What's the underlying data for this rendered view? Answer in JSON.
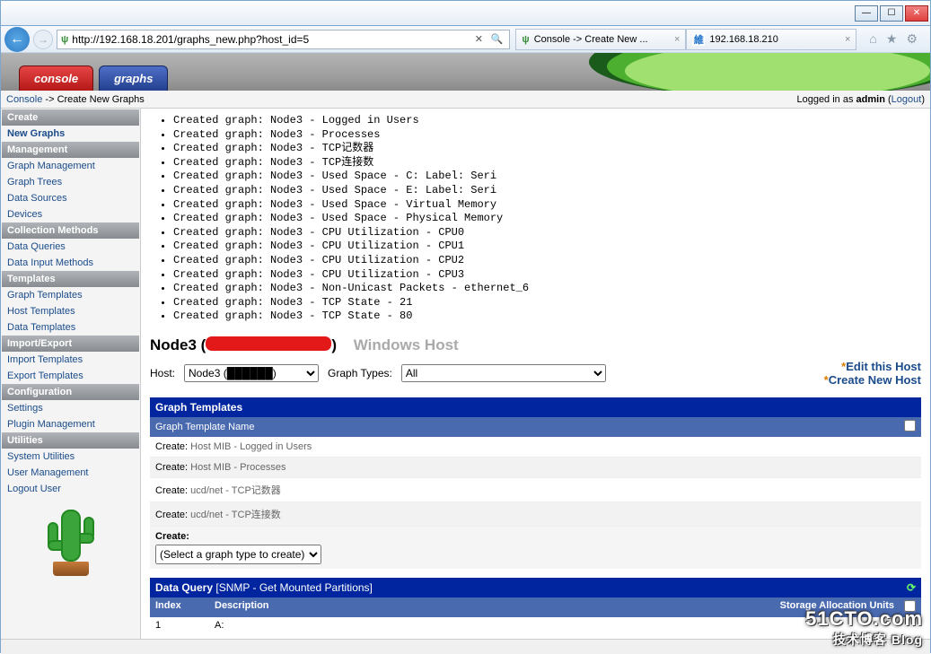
{
  "browser": {
    "url": "http://192.168.18.201/graphs_new.php?host_id=5",
    "tabs": [
      {
        "label": "Console -> Create New ..."
      },
      {
        "label": "192.168.18.210",
        "icon_text": "維"
      }
    ]
  },
  "cacti_tabs": {
    "console": "console",
    "graphs": "graphs"
  },
  "breadcrumb": {
    "console": "Console",
    "arrow": "->",
    "page": "Create New Graphs",
    "login_pre": "Logged in as ",
    "user": "admin",
    "logout": "Logout"
  },
  "sidebar": {
    "headers": {
      "create": "Create",
      "management": "Management",
      "collection": "Collection Methods",
      "templates": "Templates",
      "import_export": "Import/Export",
      "configuration": "Configuration",
      "utilities": "Utilities"
    },
    "links": {
      "new_graphs": "New Graphs",
      "graph_management": "Graph Management",
      "graph_trees": "Graph Trees",
      "data_sources": "Data Sources",
      "devices": "Devices",
      "data_queries": "Data Queries",
      "data_input": "Data Input Methods",
      "graph_templates": "Graph Templates",
      "host_templates": "Host Templates",
      "data_templates": "Data Templates",
      "import_templates": "Import Templates",
      "export_templates": "Export Templates",
      "settings": "Settings",
      "plugin_mgmt": "Plugin Management",
      "sys_util": "System Utilities",
      "user_mgmt": "User Management",
      "logout_user": "Logout User"
    }
  },
  "log_lines": [
    "Created graph: Node3 - Logged in Users",
    "Created graph: Node3 - Processes",
    "Created graph: Node3 - TCP记数器",
    "Created graph: Node3 - TCP连接数",
    "Created graph: Node3 - Used Space - C: Label: Seri",
    "Created graph: Node3 - Used Space - E: Label: Seri",
    "Created graph: Node3 - Used Space - Virtual Memory",
    "Created graph: Node3 - Used Space - Physical Memory",
    "Created graph: Node3 - CPU Utilization - CPU0",
    "Created graph: Node3 - CPU Utilization - CPU1",
    "Created graph: Node3 - CPU Utilization - CPU2",
    "Created graph: Node3 - CPU Utilization - CPU3",
    "Created graph: Node3 - Non-Unicast Packets - ethernet_6",
    "Created graph: Node3 - TCP State - 21",
    "Created graph: Node3 - TCP State - 80"
  ],
  "host_header": {
    "name_pre": "Node3 (",
    "name_post": ")",
    "type": "Windows Host"
  },
  "selectors": {
    "host_label": "Host:",
    "host_option": "Node3 (",
    "graph_types_label": "Graph Types:",
    "graph_types_option": "All"
  },
  "host_links": {
    "edit": "Edit this Host",
    "create": "Create New Host",
    "star": "*"
  },
  "graph_templates": {
    "title": "Graph Templates",
    "col": "Graph Template Name",
    "rows": [
      {
        "prefix": "Create:",
        "name": "Host MIB - Logged in Users"
      },
      {
        "prefix": "Create:",
        "name": "Host MIB - Processes"
      },
      {
        "prefix": "Create:",
        "name": "ucd/net - TCP记数器"
      },
      {
        "prefix": "Create:",
        "name": "ucd/net - TCP连接数"
      }
    ],
    "create_label": "Create:",
    "create_option": "(Select a graph type to create)"
  },
  "data_query": {
    "title": "Data Query",
    "sub": "[SNMP - Get Mounted Partitions]",
    "cols": {
      "index": "Index",
      "desc": "Description",
      "sau": "Storage Allocation Units"
    },
    "rows": [
      {
        "index": "1",
        "desc": "A:"
      }
    ]
  },
  "watermark": {
    "main": "51CTO.com",
    "sub": "技术博客    Blog"
  }
}
